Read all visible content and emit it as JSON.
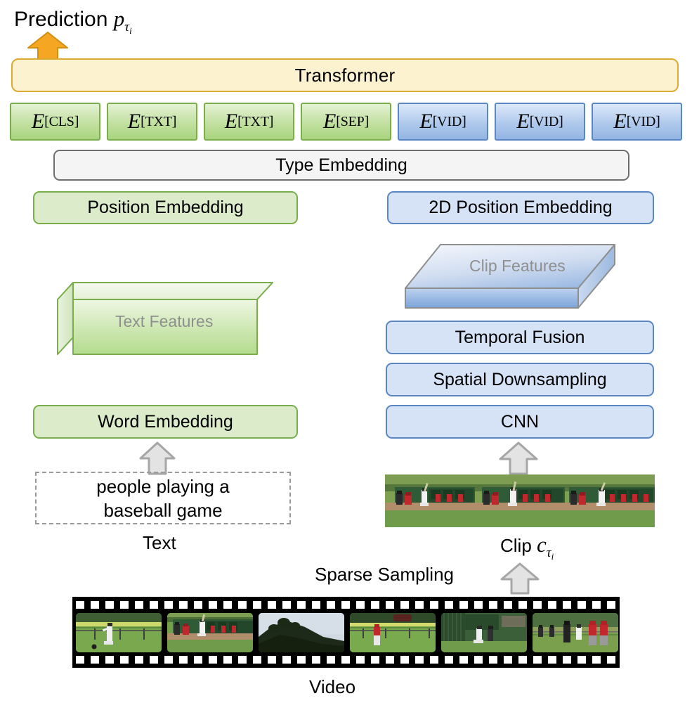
{
  "diagram": {
    "title": "ClipBERT-style video-and-language transformer architecture"
  },
  "prediction": {
    "label": "Prediction",
    "symbol": "p",
    "subscript": "τ",
    "subsubscript": "i",
    "arrow_icon": "arrow-up-icon",
    "arrow_color": "#f5a623"
  },
  "transformer": {
    "label": "Transformer",
    "fill": "#fdf2cf",
    "border": "#dbab33"
  },
  "tokens": [
    {
      "symbol": "E",
      "subscript": "[CLS]",
      "type": "text",
      "color": "#a8d47e"
    },
    {
      "symbol": "E",
      "subscript": "[TXT]",
      "type": "text",
      "color": "#a8d47e"
    },
    {
      "symbol": "E",
      "subscript": "[TXT]",
      "type": "text",
      "color": "#a8d47e"
    },
    {
      "symbol": "E",
      "subscript": "[SEP]",
      "type": "text",
      "color": "#a8d47e"
    },
    {
      "symbol": "E",
      "subscript": "[VID]",
      "type": "video",
      "color": "#93b5e3"
    },
    {
      "symbol": "E",
      "subscript": "[VID]",
      "type": "video",
      "color": "#93b5e3"
    },
    {
      "symbol": "E",
      "subscript": "[VID]",
      "type": "video",
      "color": "#93b5e3"
    }
  ],
  "type_embedding": {
    "label": "Type Embedding",
    "fill": "#f4f4f4",
    "border": "#6e6e6e"
  },
  "text_branch": {
    "position_embedding": "Position Embedding",
    "features": "Text Features",
    "word_embedding": "Word Embedding",
    "input_text": "people playing a baseball game",
    "input_text_line1": "people playing a",
    "input_text_line2": "baseball game",
    "caption": "Text",
    "arrow_icon": "arrow-up-icon",
    "accent": "#7aae4c",
    "fill": "#dceccb"
  },
  "video_branch": {
    "position_embedding": "2D Position Embedding",
    "features": "Clip Features",
    "blocks": [
      "Temporal Fusion",
      "Spatial Downsampling",
      "CNN"
    ],
    "caption_prefix": "Clip",
    "caption_symbol": "c",
    "caption_subscript": "τ",
    "caption_subsubscript": "i",
    "arrow_icon": "arrow-up-icon",
    "accent": "#5b86c4",
    "fill": "#d6e3f7"
  },
  "sampling": {
    "label": "Sparse Sampling",
    "arrow_icon": "arrow-up-icon"
  },
  "video": {
    "caption": "Video",
    "frame_count": 6,
    "frames": [
      "baseball-pitcher-field",
      "baseball-batter-at-plate",
      "hillside-trees-sky",
      "outfielder-red-shirt",
      "players-behind-fence",
      "umpire-and-players"
    ]
  },
  "clip": {
    "frame_count": 3,
    "frames": [
      "baseball-batter-swing-1",
      "baseball-batter-swing-2",
      "baseball-batter-swing-3"
    ]
  }
}
